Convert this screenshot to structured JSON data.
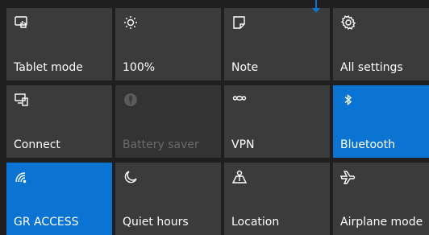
{
  "tiles": [
    {
      "label": "Tablet mode",
      "icon": "tablet-mode-icon",
      "state": "normal"
    },
    {
      "label": "100%",
      "icon": "brightness-icon",
      "state": "normal"
    },
    {
      "label": "Note",
      "icon": "note-icon",
      "state": "normal"
    },
    {
      "label": "All settings",
      "icon": "gear-icon",
      "state": "normal"
    },
    {
      "label": "Connect",
      "icon": "connect-icon",
      "state": "normal"
    },
    {
      "label": "Battery saver",
      "icon": "battery-saver-icon",
      "state": "disabled"
    },
    {
      "label": "VPN",
      "icon": "vpn-icon",
      "state": "normal"
    },
    {
      "label": "Bluetooth",
      "icon": "bluetooth-icon",
      "state": "active"
    },
    {
      "label": "GR ACCESS",
      "icon": "wifi-icon",
      "state": "active"
    },
    {
      "label": "Quiet hours",
      "icon": "moon-icon",
      "state": "normal"
    },
    {
      "label": "Location",
      "icon": "location-icon",
      "state": "normal"
    },
    {
      "label": "Airplane mode",
      "icon": "airplane-icon",
      "state": "normal"
    }
  ],
  "colors": {
    "background": "#1f1f1f",
    "tile": "#3b3b3b",
    "active": "#0b73d1",
    "disabled_text": "#6b6b6b",
    "pointer": "#0b73d1"
  },
  "pointer_icon": "arrow-down-icon"
}
